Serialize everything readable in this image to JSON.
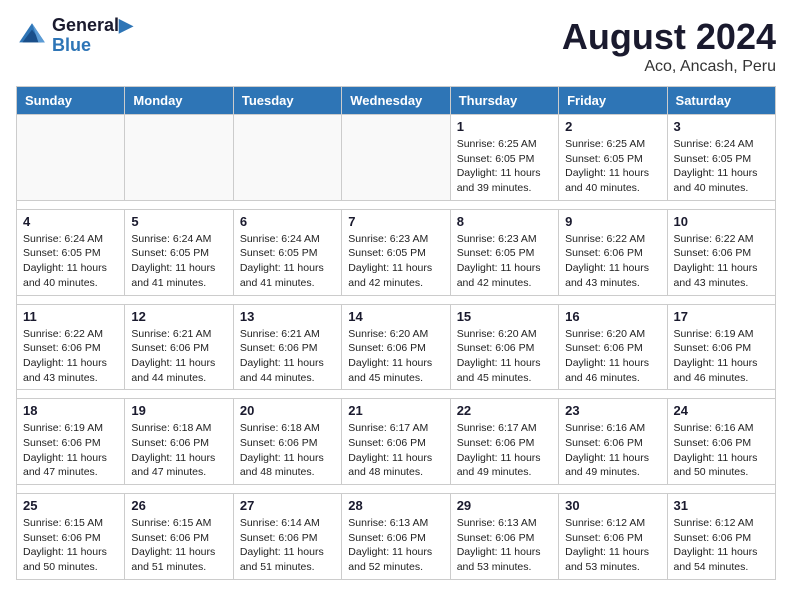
{
  "header": {
    "logo_line1": "General",
    "logo_line2": "Blue",
    "title": "August 2024",
    "subtitle": "Aco, Ancash, Peru"
  },
  "days_of_week": [
    "Sunday",
    "Monday",
    "Tuesday",
    "Wednesday",
    "Thursday",
    "Friday",
    "Saturday"
  ],
  "weeks": [
    [
      {
        "day": "",
        "info": ""
      },
      {
        "day": "",
        "info": ""
      },
      {
        "day": "",
        "info": ""
      },
      {
        "day": "",
        "info": ""
      },
      {
        "day": "1",
        "info": "Sunrise: 6:25 AM\nSunset: 6:05 PM\nDaylight: 11 hours and 39 minutes."
      },
      {
        "day": "2",
        "info": "Sunrise: 6:25 AM\nSunset: 6:05 PM\nDaylight: 11 hours and 40 minutes."
      },
      {
        "day": "3",
        "info": "Sunrise: 6:24 AM\nSunset: 6:05 PM\nDaylight: 11 hours and 40 minutes."
      }
    ],
    [
      {
        "day": "4",
        "info": "Sunrise: 6:24 AM\nSunset: 6:05 PM\nDaylight: 11 hours and 40 minutes."
      },
      {
        "day": "5",
        "info": "Sunrise: 6:24 AM\nSunset: 6:05 PM\nDaylight: 11 hours and 41 minutes."
      },
      {
        "day": "6",
        "info": "Sunrise: 6:24 AM\nSunset: 6:05 PM\nDaylight: 11 hours and 41 minutes."
      },
      {
        "day": "7",
        "info": "Sunrise: 6:23 AM\nSunset: 6:05 PM\nDaylight: 11 hours and 42 minutes."
      },
      {
        "day": "8",
        "info": "Sunrise: 6:23 AM\nSunset: 6:05 PM\nDaylight: 11 hours and 42 minutes."
      },
      {
        "day": "9",
        "info": "Sunrise: 6:22 AM\nSunset: 6:06 PM\nDaylight: 11 hours and 43 minutes."
      },
      {
        "day": "10",
        "info": "Sunrise: 6:22 AM\nSunset: 6:06 PM\nDaylight: 11 hours and 43 minutes."
      }
    ],
    [
      {
        "day": "11",
        "info": "Sunrise: 6:22 AM\nSunset: 6:06 PM\nDaylight: 11 hours and 43 minutes."
      },
      {
        "day": "12",
        "info": "Sunrise: 6:21 AM\nSunset: 6:06 PM\nDaylight: 11 hours and 44 minutes."
      },
      {
        "day": "13",
        "info": "Sunrise: 6:21 AM\nSunset: 6:06 PM\nDaylight: 11 hours and 44 minutes."
      },
      {
        "day": "14",
        "info": "Sunrise: 6:20 AM\nSunset: 6:06 PM\nDaylight: 11 hours and 45 minutes."
      },
      {
        "day": "15",
        "info": "Sunrise: 6:20 AM\nSunset: 6:06 PM\nDaylight: 11 hours and 45 minutes."
      },
      {
        "day": "16",
        "info": "Sunrise: 6:20 AM\nSunset: 6:06 PM\nDaylight: 11 hours and 46 minutes."
      },
      {
        "day": "17",
        "info": "Sunrise: 6:19 AM\nSunset: 6:06 PM\nDaylight: 11 hours and 46 minutes."
      }
    ],
    [
      {
        "day": "18",
        "info": "Sunrise: 6:19 AM\nSunset: 6:06 PM\nDaylight: 11 hours and 47 minutes."
      },
      {
        "day": "19",
        "info": "Sunrise: 6:18 AM\nSunset: 6:06 PM\nDaylight: 11 hours and 47 minutes."
      },
      {
        "day": "20",
        "info": "Sunrise: 6:18 AM\nSunset: 6:06 PM\nDaylight: 11 hours and 48 minutes."
      },
      {
        "day": "21",
        "info": "Sunrise: 6:17 AM\nSunset: 6:06 PM\nDaylight: 11 hours and 48 minutes."
      },
      {
        "day": "22",
        "info": "Sunrise: 6:17 AM\nSunset: 6:06 PM\nDaylight: 11 hours and 49 minutes."
      },
      {
        "day": "23",
        "info": "Sunrise: 6:16 AM\nSunset: 6:06 PM\nDaylight: 11 hours and 49 minutes."
      },
      {
        "day": "24",
        "info": "Sunrise: 6:16 AM\nSunset: 6:06 PM\nDaylight: 11 hours and 50 minutes."
      }
    ],
    [
      {
        "day": "25",
        "info": "Sunrise: 6:15 AM\nSunset: 6:06 PM\nDaylight: 11 hours and 50 minutes."
      },
      {
        "day": "26",
        "info": "Sunrise: 6:15 AM\nSunset: 6:06 PM\nDaylight: 11 hours and 51 minutes."
      },
      {
        "day": "27",
        "info": "Sunrise: 6:14 AM\nSunset: 6:06 PM\nDaylight: 11 hours and 51 minutes."
      },
      {
        "day": "28",
        "info": "Sunrise: 6:13 AM\nSunset: 6:06 PM\nDaylight: 11 hours and 52 minutes."
      },
      {
        "day": "29",
        "info": "Sunrise: 6:13 AM\nSunset: 6:06 PM\nDaylight: 11 hours and 53 minutes."
      },
      {
        "day": "30",
        "info": "Sunrise: 6:12 AM\nSunset: 6:06 PM\nDaylight: 11 hours and 53 minutes."
      },
      {
        "day": "31",
        "info": "Sunrise: 6:12 AM\nSunset: 6:06 PM\nDaylight: 11 hours and 54 minutes."
      }
    ]
  ]
}
